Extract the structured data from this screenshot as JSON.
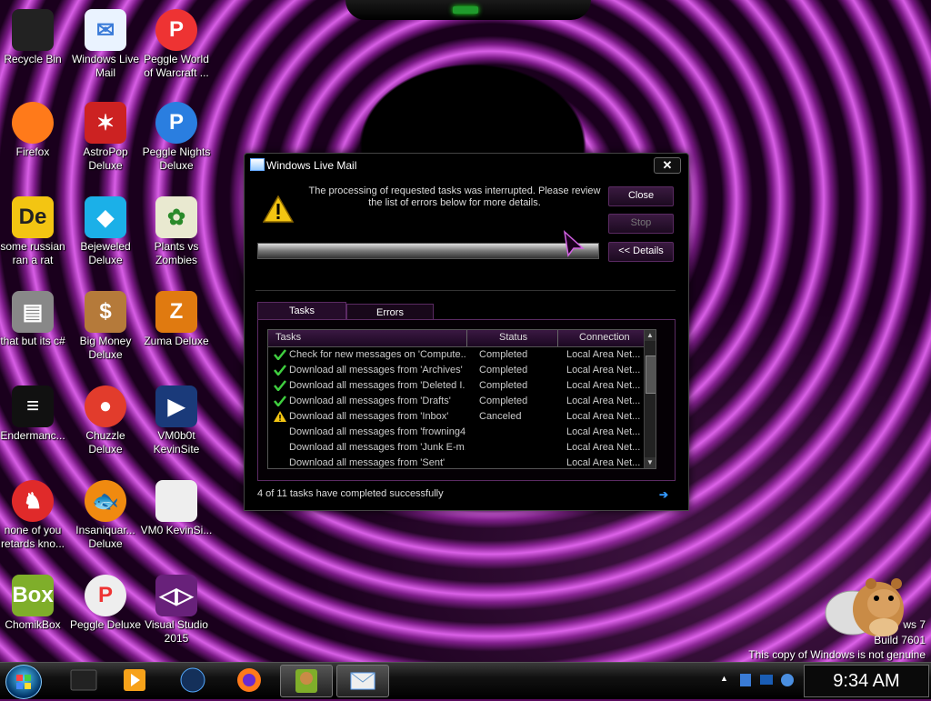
{
  "desktop": {
    "icons": [
      {
        "label": "Recycle Bin"
      },
      {
        "label": "Windows Live Mail"
      },
      {
        "label": "Peggle World of Warcraft ..."
      },
      {
        "label": "Firefox"
      },
      {
        "label": "AstroPop Deluxe"
      },
      {
        "label": "Peggle Nights Deluxe"
      },
      {
        "label": "some russian ran a rat"
      },
      {
        "label": "Bejeweled Deluxe"
      },
      {
        "label": "Plants vs Zombies"
      },
      {
        "label": "that but its c#"
      },
      {
        "label": "Big Money Deluxe"
      },
      {
        "label": "Zuma Deluxe"
      },
      {
        "label": "Endermanc..."
      },
      {
        "label": "Chuzzle Deluxe"
      },
      {
        "label": "VM0b0t KevinSite"
      },
      {
        "label": "none of you retards kno..."
      },
      {
        "label": "Insaniquar... Deluxe"
      },
      {
        "label": "VM0 KevinSi..."
      },
      {
        "label": "ChomikBox"
      },
      {
        "label": "Peggle Deluxe"
      },
      {
        "label": "Visual Studio 2015"
      }
    ]
  },
  "dialog": {
    "title": "Windows Live Mail",
    "close_glyph": "✕",
    "message": "The processing of requested tasks was interrupted.  Please review the list of errors below for more details.",
    "buttons": {
      "close": "Close",
      "stop": "Stop",
      "details": "<< Details"
    },
    "progress": 1.0,
    "tabs": [
      "Tasks",
      "Errors"
    ],
    "columns": [
      "Tasks",
      "Status",
      "Connection"
    ],
    "rows": [
      {
        "icon": "check",
        "task": "Check for new messages on 'Compute...",
        "status": "Completed",
        "connection": "Local Area Net..."
      },
      {
        "icon": "check",
        "task": "Download all messages from 'Archives'",
        "status": "Completed",
        "connection": "Local Area Net..."
      },
      {
        "icon": "check",
        "task": "Download all messages from 'Deleted I...",
        "status": "Completed",
        "connection": "Local Area Net..."
      },
      {
        "icon": "check",
        "task": "Download all messages from 'Drafts'",
        "status": "Completed",
        "connection": "Local Area Net..."
      },
      {
        "icon": "warning",
        "task": "Download all messages from 'Inbox'",
        "status": "Canceled",
        "connection": "Local Area Net..."
      },
      {
        "icon": "none",
        "task": "Download all messages from 'frowning4'",
        "status": "",
        "connection": "Local Area Net..."
      },
      {
        "icon": "none",
        "task": "Download all messages from 'Junk E-m...",
        "status": "",
        "connection": "Local Area Net..."
      },
      {
        "icon": "none",
        "task": "Download all messages from 'Sent'",
        "status": "",
        "connection": "Local Area Net..."
      }
    ],
    "summary": "4 of 11 tasks have completed successfully"
  },
  "watermark": {
    "line1": "ws 7",
    "line2": "Build 7601",
    "line3": "This copy of Windows is not genuine"
  },
  "taskbar": {
    "clock": "9:34 AM"
  },
  "colors": {
    "accent": "#5a2a62",
    "check": "#3fcf3f",
    "warning": "#f3c512",
    "wallpaper": "#c04ccc"
  }
}
